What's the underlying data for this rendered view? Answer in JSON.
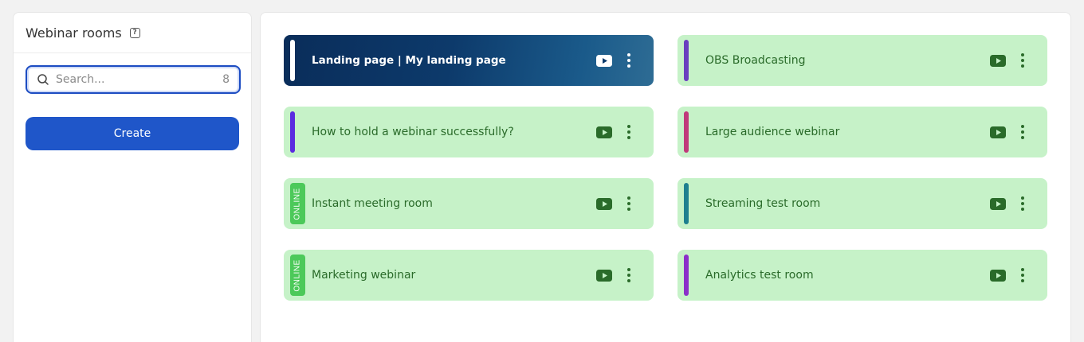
{
  "sidebar": {
    "title": "Webinar rooms",
    "help_icon": "question-square-icon",
    "search": {
      "placeholder": "Search...",
      "value": "",
      "count": "8"
    },
    "create_label": "Create",
    "colors": {
      "accent": "#1f56c9"
    }
  },
  "rooms": [
    {
      "title": "Landing page  |  My landing page",
      "style": "banner",
      "accent": "#ffffff"
    },
    {
      "title": "OBS Broadcasting",
      "accent": "#6a3fbf"
    },
    {
      "title": "How to hold a webinar successfully?",
      "accent": "#5b2be0"
    },
    {
      "title": "Large audience webinar",
      "accent": "#c0397a"
    },
    {
      "title": "Instant meeting room",
      "status": "ONLINE",
      "accent": "#4cc95a"
    },
    {
      "title": "Streaming test room",
      "accent": "#1e7f8f"
    },
    {
      "title": "Marketing webinar",
      "status": "ONLINE",
      "accent": "#4cc95a"
    },
    {
      "title": "Analytics test room",
      "accent": "#8b2fc9"
    }
  ],
  "icons": {
    "play": "youtube-play-icon",
    "more": "more-vertical-icon",
    "search": "search-icon"
  },
  "colors": {
    "card_bg": "#c6f2c8",
    "text_green": "#2a6b2a",
    "online": "#4cc95a"
  }
}
